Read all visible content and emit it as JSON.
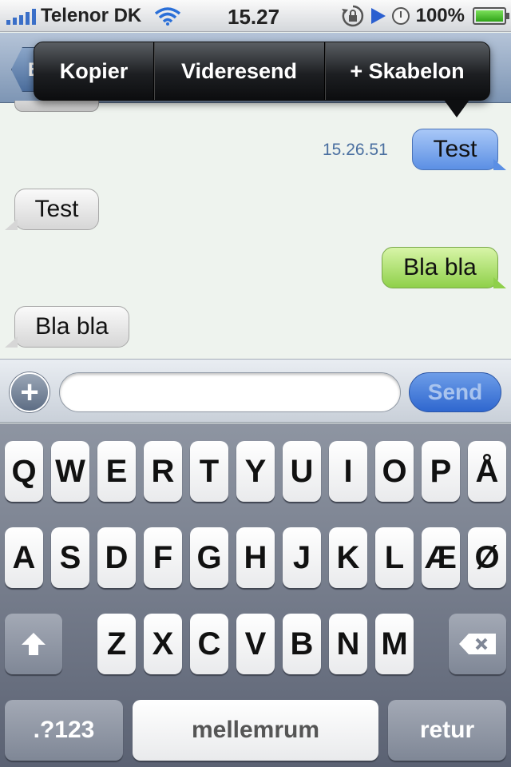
{
  "status_bar": {
    "carrier": "Telenor DK",
    "time": "15.27",
    "battery": "100%",
    "battery_level": 1.0,
    "signal_bars": 5
  },
  "nav": {
    "back_label": "B"
  },
  "context_menu": {
    "copy": "Kopier",
    "forward": "Videresend",
    "template": "+ Skabelon"
  },
  "messages": [
    {
      "text": "Test",
      "type": "sent",
      "color": "#5b8fe4",
      "timestamp": "15.26.51"
    },
    {
      "text": "Test",
      "type": "received"
    },
    {
      "text": "Bla bla",
      "type": "sent",
      "color": "#8fd04a"
    },
    {
      "text": "Bla bla",
      "type": "received"
    }
  ],
  "compose": {
    "add_label": "+",
    "input_value": "",
    "send_label": "Send"
  },
  "keyboard": {
    "row1": [
      "Q",
      "W",
      "E",
      "R",
      "T",
      "Y",
      "U",
      "I",
      "O",
      "P",
      "Å"
    ],
    "row2": [
      "A",
      "S",
      "D",
      "F",
      "G",
      "H",
      "J",
      "K",
      "L",
      "Æ",
      "Ø"
    ],
    "row3": [
      "Z",
      "X",
      "C",
      "V",
      "B",
      "N",
      "M"
    ],
    "numbers_label": ".?123",
    "space_label": "mellemrum",
    "return_label": "retur"
  }
}
